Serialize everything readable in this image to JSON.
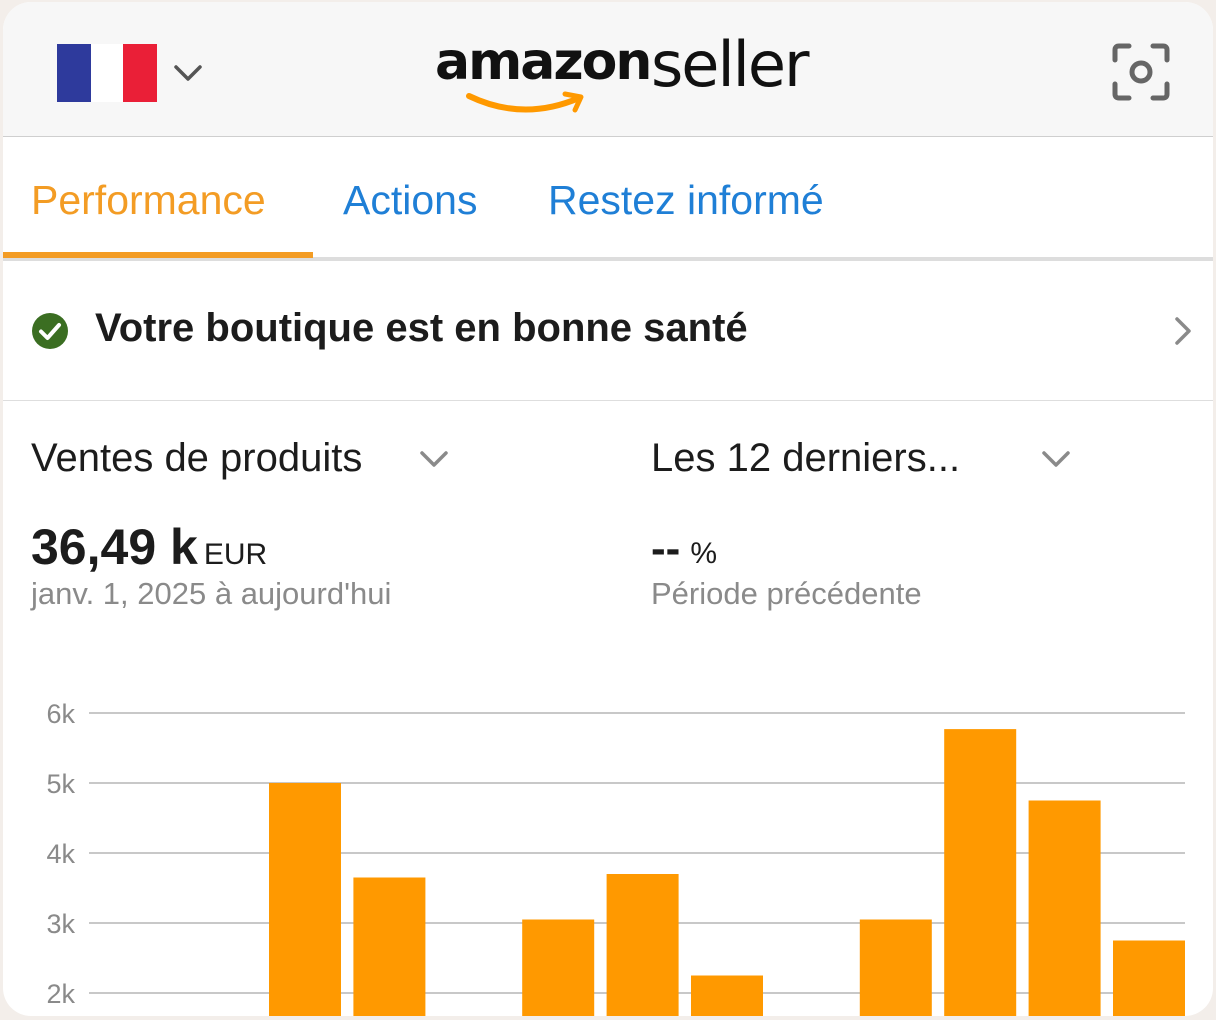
{
  "header": {
    "flag_icon": "france-flag-icon",
    "logo_word_amazon": "amazon",
    "logo_word_seller": "seller",
    "scan_icon": "scan-camera-icon"
  },
  "tabs": [
    {
      "label": "Performance",
      "active": true
    },
    {
      "label": "Actions",
      "active": false
    },
    {
      "label": "Restez informé",
      "active": false
    }
  ],
  "health": {
    "text": "Votre boutique est en bonne santé",
    "status_color": "#3b6e22"
  },
  "metric": {
    "selector_label": "Ventes de produits",
    "value": "36,49 k",
    "unit": "EUR",
    "date_range": "janv. 1, 2025 à aujourd'hui"
  },
  "period": {
    "selector_label": "Les 12 derniers...",
    "value": "--",
    "unit": "%",
    "comparison_label": "Période précédente"
  },
  "colors": {
    "accent": "#f39c24",
    "link": "#1f7fd6",
    "bar": "#ff9900"
  },
  "chart_data": {
    "type": "bar",
    "ytick_labels": [
      "6k",
      "5k",
      "4k",
      "3k",
      "2k"
    ],
    "yticks": [
      6000,
      5000,
      4000,
      3000,
      2000
    ],
    "ylim": [
      1650,
      6000
    ],
    "values": [
      null,
      null,
      5000,
      3650,
      null,
      3050,
      3700,
      2250,
      null,
      3050,
      5770,
      4750,
      2750
    ],
    "grid": true,
    "legend": "none"
  }
}
